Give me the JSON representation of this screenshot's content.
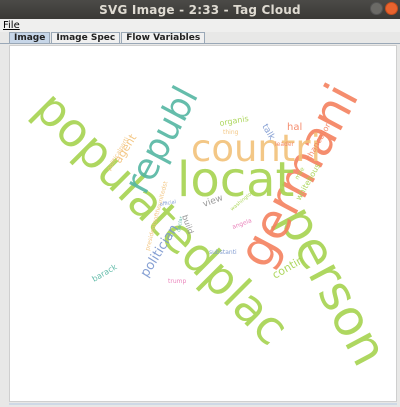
{
  "window": {
    "title": "SVG Image - 2:33 - Tag Cloud"
  },
  "menu": {
    "file_label": "File"
  },
  "tabs": [
    {
      "label": "Image",
      "active": true
    },
    {
      "label": "Image Spec",
      "active": false
    },
    {
      "label": "Flow Variables",
      "active": false
    }
  ],
  "tag_cloud": {
    "words": [
      {
        "text": "populatedplac",
        "color": "#a6d34f"
      },
      {
        "text": "person",
        "color": "#a6d34f"
      },
      {
        "text": "germani",
        "color": "#f4815f"
      },
      {
        "text": "locat",
        "color": "#a6d34f"
      },
      {
        "text": "countri",
        "color": "#f2c27a"
      },
      {
        "text": "republ",
        "color": "#55b6a2"
      },
      {
        "text": "politician",
        "color": "#7a96cf"
      },
      {
        "text": "agent",
        "color": "#f2c27a"
      },
      {
        "text": "contin",
        "color": "#a6d34f"
      },
      {
        "text": "barack",
        "color": "#55b6a2"
      },
      {
        "text": "chancellor",
        "color": "#f4815f"
      },
      {
        "text": "whitehous",
        "color": "#a6d34f"
      },
      {
        "text": "hal",
        "color": "#f4815f"
      },
      {
        "text": "view",
        "color": "#8f8f8f"
      },
      {
        "text": "build",
        "color": "#8f8f8f"
      },
      {
        "text": "substanti",
        "color": "#7a96cf"
      },
      {
        "text": "angela",
        "color": "#e878b5"
      },
      {
        "text": "trump",
        "color": "#e878b5"
      },
      {
        "text": "talk",
        "color": "#7a96cf"
      },
      {
        "text": "organis",
        "color": "#a6d34f"
      },
      {
        "text": "presidentsoftheunitedst",
        "color": "#f2c27a"
      },
      {
        "text": "politicalparti",
        "color": "#f2c27a"
      },
      {
        "text": "washington",
        "color": "#a6d34f"
      },
      {
        "text": "thing",
        "color": "#f2c27a"
      },
      {
        "text": "leader",
        "color": "#f4815f"
      },
      {
        "text": "official",
        "color": "#7a96cf"
      },
      {
        "text": "declar",
        "color": "#55b6a2"
      },
      {
        "text": "mae",
        "color": "#a6d34f"
      }
    ]
  }
}
